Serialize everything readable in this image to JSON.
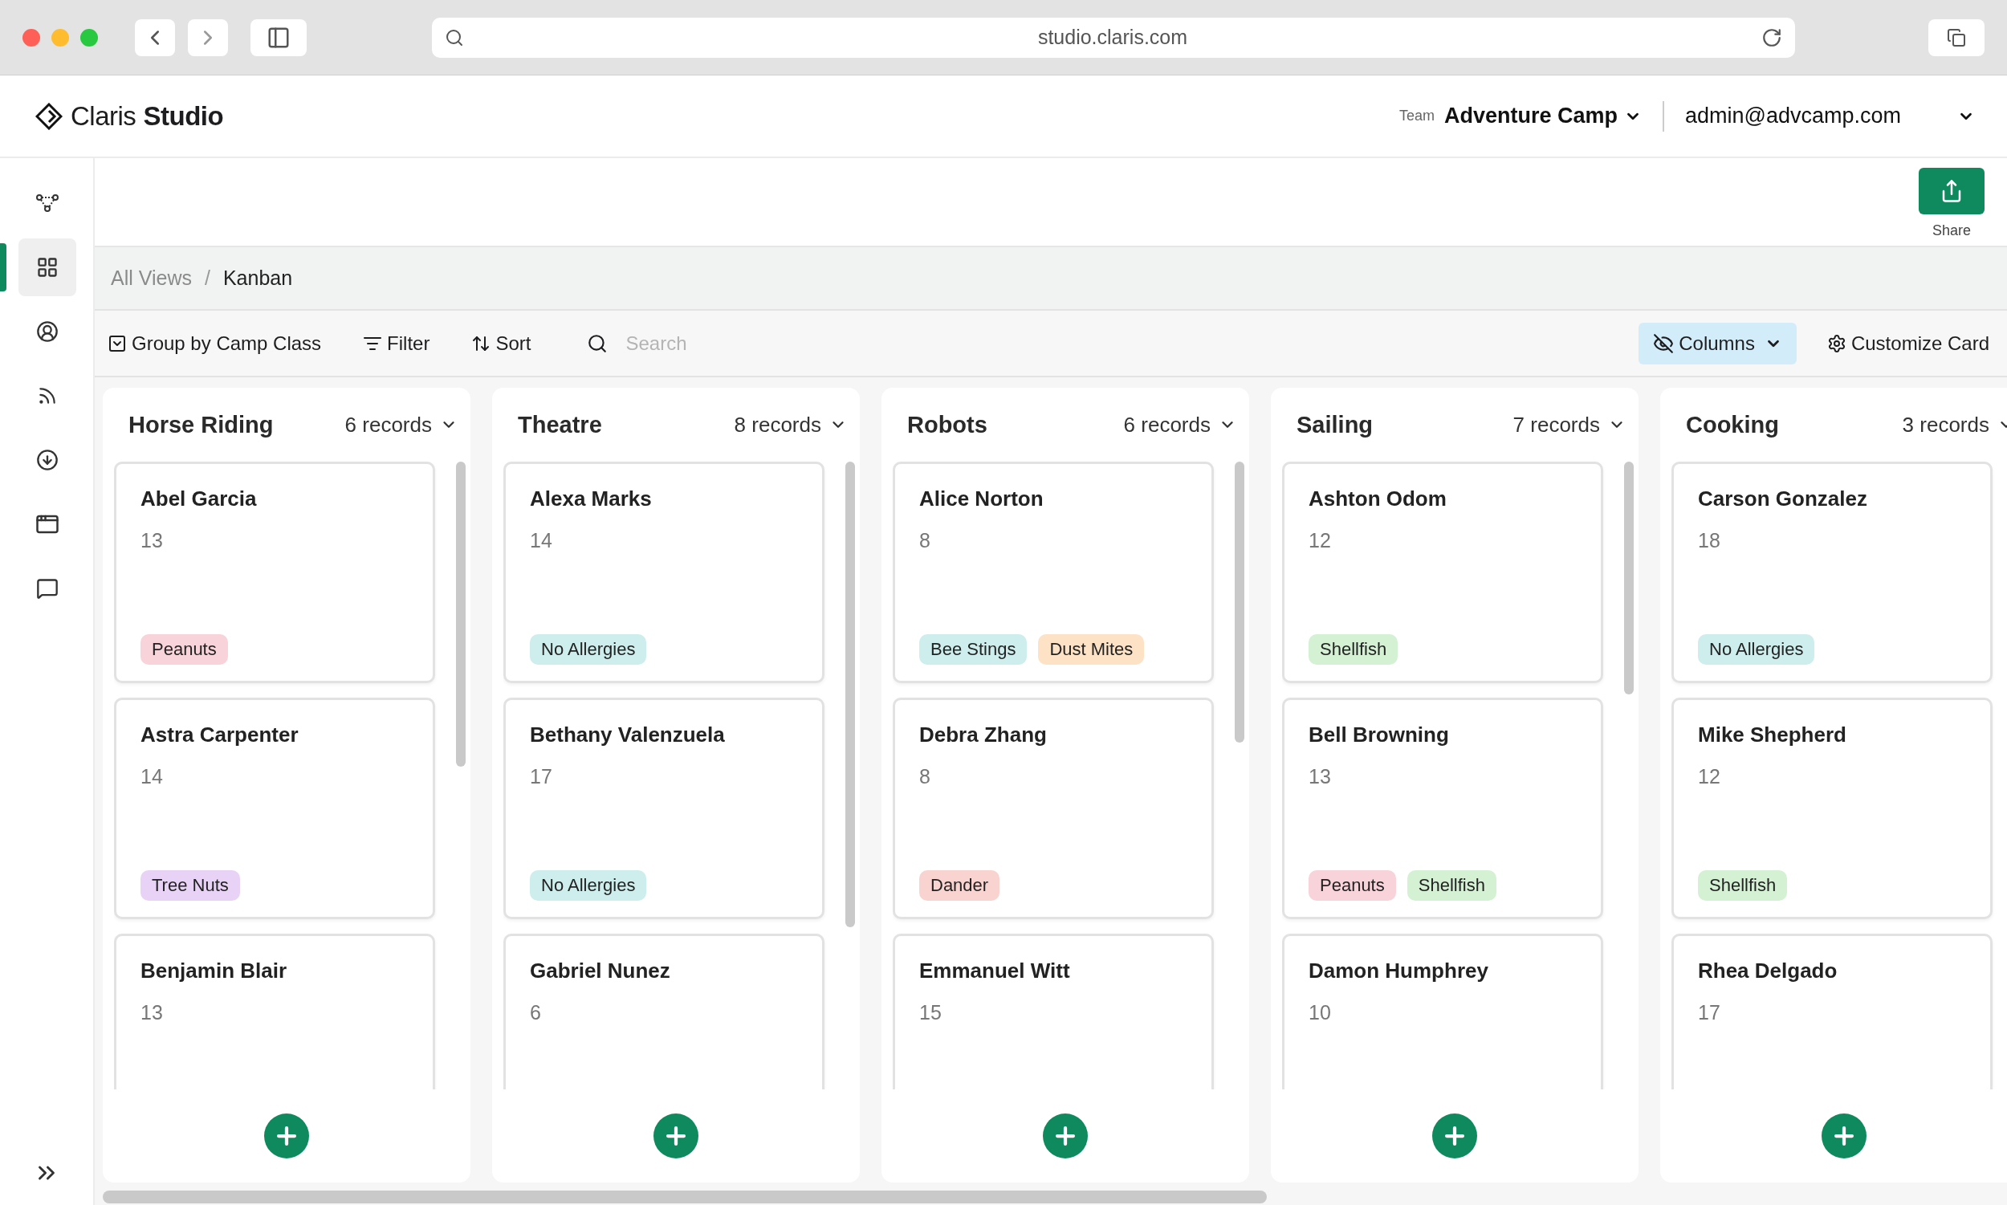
{
  "browser": {
    "url": "studio.claris.com"
  },
  "header": {
    "logo_light": "Claris",
    "logo_bold": "Studio",
    "team_label": "Team",
    "team": "Adventure Camp",
    "user": "admin@advcamp.com"
  },
  "sidebar": {
    "items": [
      {
        "kind": "nodes",
        "selected": false
      },
      {
        "kind": "grid",
        "selected": true
      },
      {
        "kind": "user",
        "selected": false
      },
      {
        "kind": "feed",
        "selected": false
      },
      {
        "kind": "download",
        "selected": false
      },
      {
        "kind": "window",
        "selected": false
      },
      {
        "kind": "chat",
        "selected": false
      }
    ]
  },
  "share": {
    "label": "Share"
  },
  "breadcrumb": {
    "items": [
      "All Views",
      "Kanban"
    ],
    "separator": "/"
  },
  "toolbar": {
    "group_by": "Group by Camp Class",
    "filter": "Filter",
    "sort": "Sort",
    "search": {
      "placeholder": "Search"
    },
    "columns": {
      "label": "Columns",
      "active": true
    },
    "customize": "Customize Card"
  },
  "board": {
    "columns": [
      {
        "title": "Horse Riding",
        "count": "6 records",
        "cards": [
          {
            "name": "Abel Garcia",
            "age": "13",
            "tags": [
              {
                "label": "Peanuts",
                "color": "#f9d3da"
              }
            ]
          },
          {
            "name": "Astra Carpenter",
            "age": "14",
            "tags": [
              {
                "label": "Tree Nuts",
                "color": "#e8d3f6"
              }
            ]
          },
          {
            "name": "Benjamin Blair",
            "age": "13"
          }
        ]
      },
      {
        "title": "Theatre",
        "count": "8 records",
        "cards": [
          {
            "name": "Alexa Marks",
            "age": "14",
            "tags": [
              {
                "label": "No Allergies",
                "color": "#cdeeec"
              }
            ]
          },
          {
            "name": "Bethany Valenzuela",
            "age": "17",
            "tags": [
              {
                "label": "No Allergies",
                "color": "#cdeeec"
              }
            ]
          },
          {
            "name": "Gabriel Nunez",
            "age": "6"
          }
        ]
      },
      {
        "title": "Robots",
        "count": "6 records",
        "cards": [
          {
            "name": "Alice Norton",
            "age": "8",
            "tags": [
              {
                "label": "Bee Stings",
                "color": "#cdeeec"
              },
              {
                "label": "Dust Mites",
                "color": "#fde2c6"
              }
            ]
          },
          {
            "name": "Debra Zhang",
            "age": "8",
            "tags": [
              {
                "label": "Dander",
                "color": "#f9d3d0"
              }
            ]
          },
          {
            "name": "Emmanuel Witt",
            "age": "15"
          }
        ]
      },
      {
        "title": "Sailing",
        "count": "7 records",
        "cards": [
          {
            "name": "Ashton Odom",
            "age": "12",
            "tags": [
              {
                "label": "Shellfish",
                "color": "#d4f1d4"
              }
            ]
          },
          {
            "name": "Bell Browning",
            "age": "13",
            "tags": [
              {
                "label": "Peanuts",
                "color": "#f9d3da"
              },
              {
                "label": "Shellfish",
                "color": "#d4f1d4"
              }
            ]
          },
          {
            "name": "Damon Humphrey",
            "age": "10"
          }
        ]
      },
      {
        "title": "Cooking",
        "count": "3 records",
        "cards": [
          {
            "name": "Carson Gonzalez",
            "age": "18",
            "tags": [
              {
                "label": "No Allergies",
                "color": "#cdeeec"
              }
            ]
          },
          {
            "name": "Mike Shepherd",
            "age": "12",
            "tags": [
              {
                "label": "Shellfish",
                "color": "#d4f1d4"
              }
            ]
          },
          {
            "name": "Rhea Delgado",
            "age": "17"
          }
        ]
      }
    ]
  }
}
